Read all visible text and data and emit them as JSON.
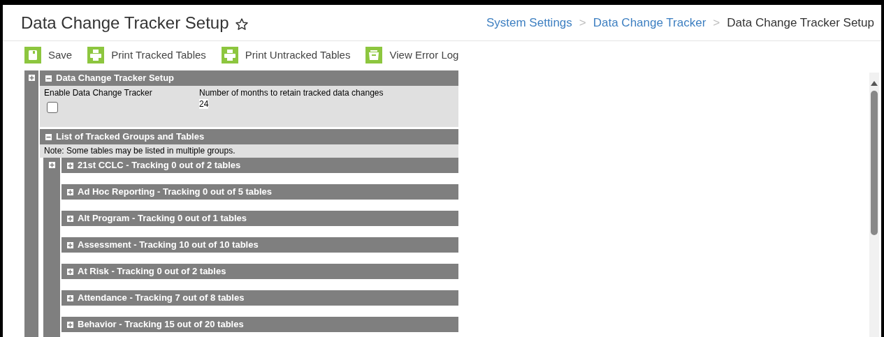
{
  "page": {
    "title": "Data Change Tracker Setup",
    "favorite": false
  },
  "breadcrumbs": [
    {
      "label": "System Settings",
      "current": false
    },
    {
      "label": "Data Change Tracker",
      "current": false
    },
    {
      "label": "Data Change Tracker Setup",
      "current": true
    }
  ],
  "separator": ">",
  "toolbar": [
    {
      "kind": "save",
      "label": "Save"
    },
    {
      "kind": "print",
      "label": "Print Tracked Tables"
    },
    {
      "kind": "print",
      "label": "Print Untracked Tables"
    },
    {
      "kind": "log",
      "label": "View Error Log"
    }
  ],
  "setup": {
    "title": "Data Change Tracker Setup",
    "expanded": true,
    "enable_label": "Enable Data Change Tracker",
    "enable_checked": false,
    "months_label": "Number of months to retain tracked data changes",
    "months_value": "24"
  },
  "list": {
    "title": "List of Tracked Groups and Tables",
    "expanded": true,
    "note": "Note: Some tables may be listed in multiple groups.",
    "groups": [
      {
        "label": "21st CCLC - Tracking 0 out of 2 tables",
        "expanded": false
      },
      {
        "label": "Ad Hoc Reporting - Tracking 0 out of 5 tables",
        "expanded": false
      },
      {
        "label": "Alt Program - Tracking 0 out of 1 tables",
        "expanded": false
      },
      {
        "label": "Assessment - Tracking 10 out of 10 tables",
        "expanded": false
      },
      {
        "label": "At Risk - Tracking 0 out of 2 tables",
        "expanded": false
      },
      {
        "label": "Attendance - Tracking 7 out of 8 tables",
        "expanded": false
      },
      {
        "label": "Behavior - Tracking 15 out of 20 tables",
        "expanded": false
      }
    ]
  }
}
